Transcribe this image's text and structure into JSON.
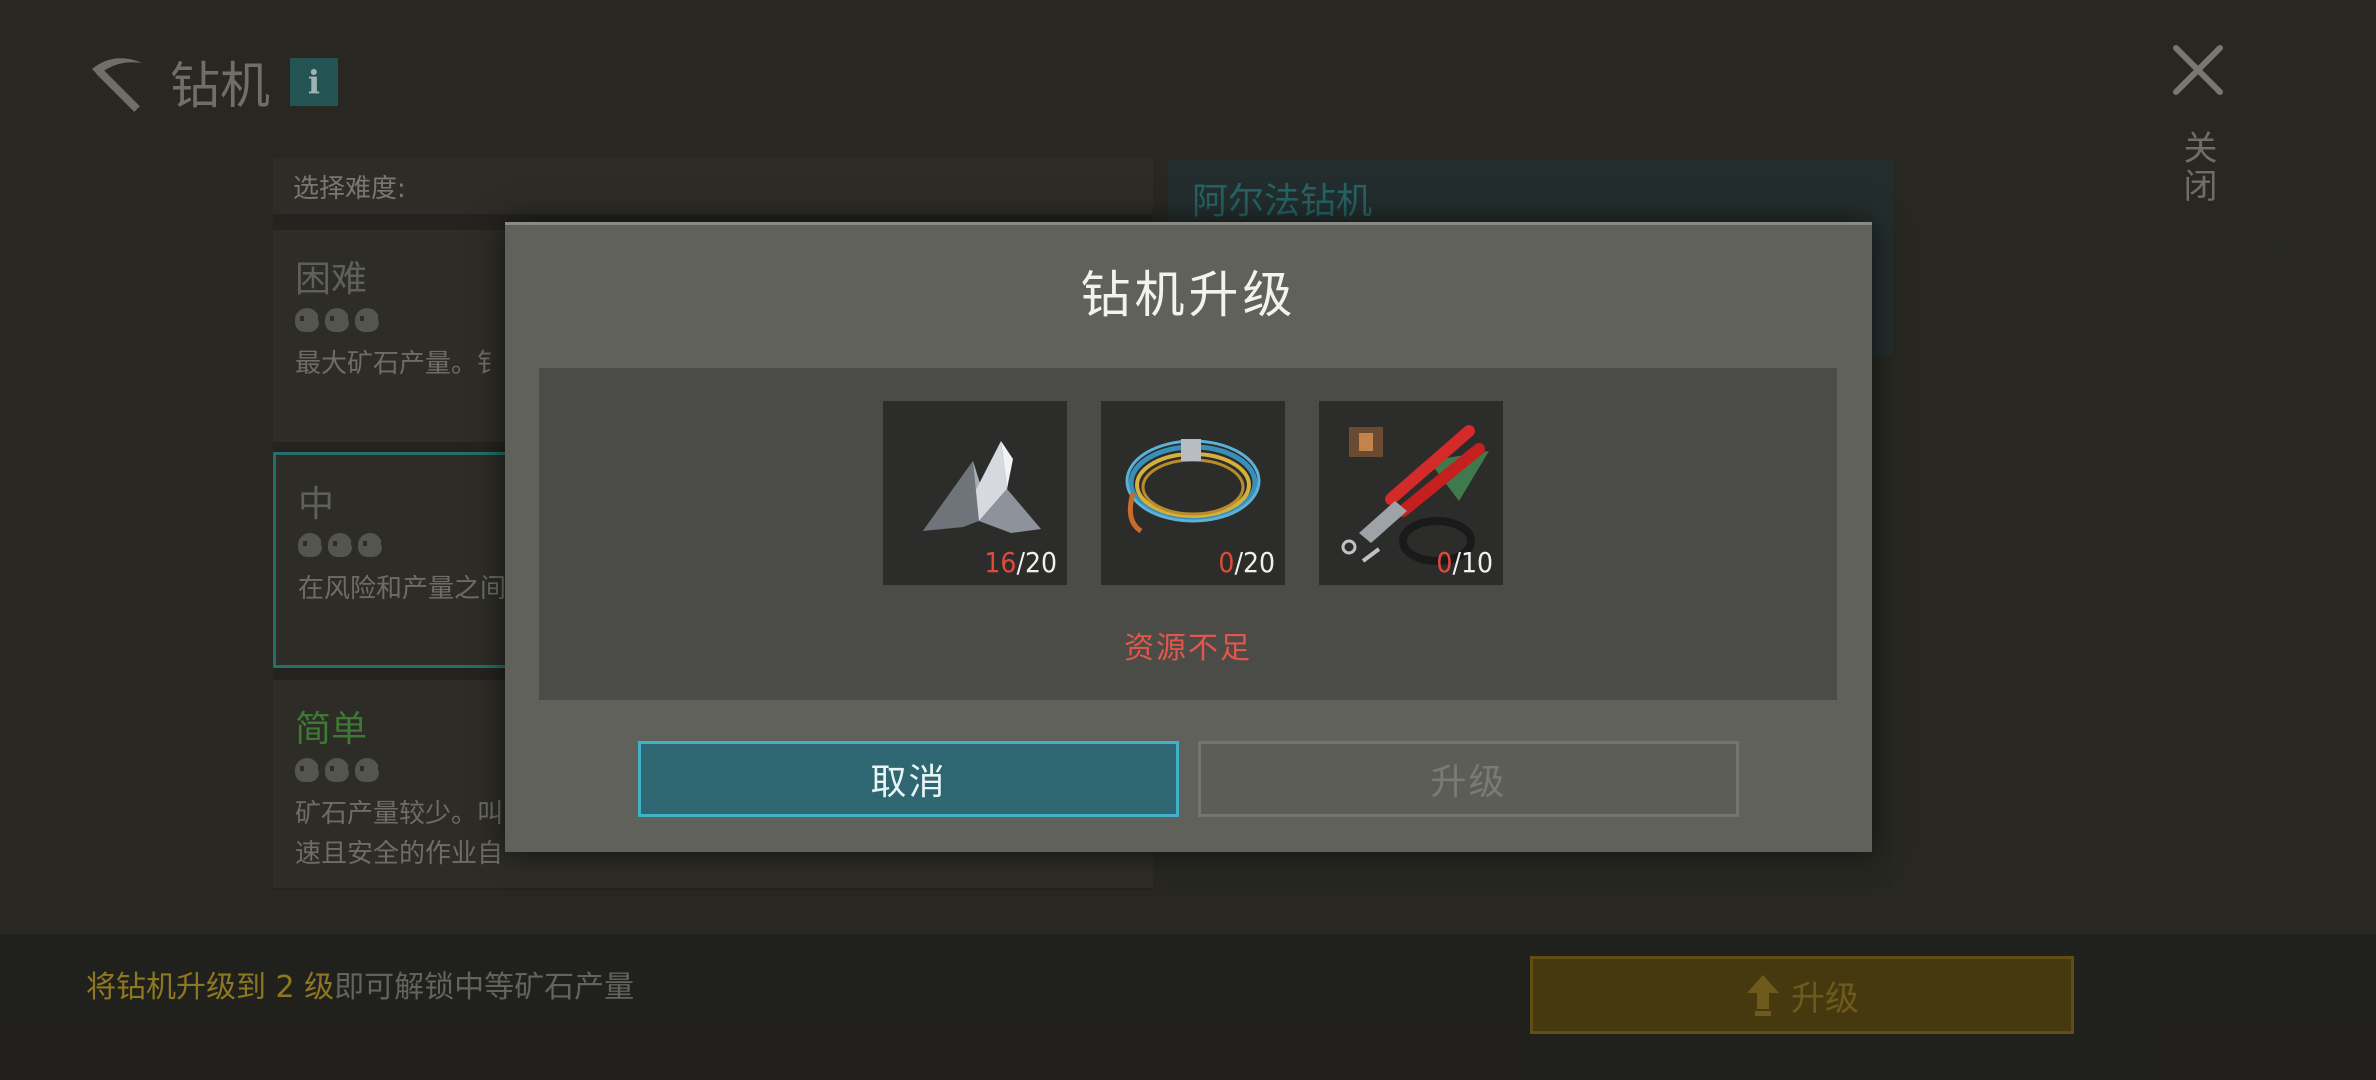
{
  "header": {
    "title": "钻机",
    "info_label": "i",
    "close_label": "关闭"
  },
  "difficulty": {
    "header": "选择难度:",
    "options": [
      {
        "title": "困难",
        "skulls": 3,
        "desc": "最大矿石产量。钅"
      },
      {
        "title": "中",
        "skulls": 3,
        "desc": "在风险和产量之间",
        "selected": true
      },
      {
        "title": "简单",
        "skulls": 3,
        "desc_line1": "矿石产量较少。叫",
        "desc_line2": "速且安全的作业自"
      }
    ]
  },
  "drill_panel": {
    "title": "阿尔法钻机"
  },
  "bottom": {
    "note_highlight": "将钻机升级到 2 级",
    "note_rest": "即可解锁中等矿石产量",
    "upgrade_label": "升级"
  },
  "modal": {
    "title": "钻机升级",
    "resources": [
      {
        "icon": "metal-scrap-icon",
        "have": "16",
        "need": "/20"
      },
      {
        "icon": "wire-coil-icon",
        "have": "0",
        "need": "/20"
      },
      {
        "icon": "pliers-toolkit-icon",
        "have": "0",
        "need": "/10"
      }
    ],
    "warning": "资源不足",
    "cancel_label": "取消",
    "upgrade_label": "升级"
  },
  "colors": {
    "accent_teal": "#3fb2c9",
    "insufficient_red": "#e1574a",
    "upgrade_gold": "#b59a2c"
  }
}
